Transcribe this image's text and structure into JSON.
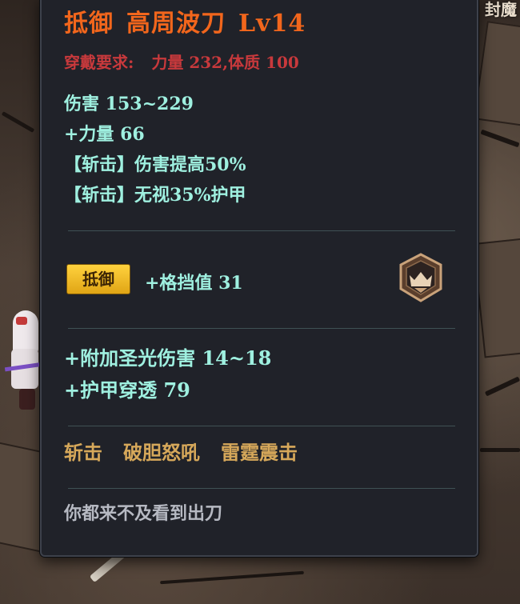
{
  "background": {
    "corner_text": "封魔"
  },
  "item": {
    "type_label": "抵御",
    "name": "高周波刀",
    "level": "Lv14",
    "requirement_label": "穿戴要求:",
    "requirement_value": "力量 232,体质 100"
  },
  "base_stats": [
    "伤害   153~229",
    "+力量 66",
    "【斩击】伤害提高50%",
    "【斩击】无视35%护甲"
  ],
  "affix": {
    "badge_label": "抵御",
    "stat": "+格挡值 31",
    "icon": "shield-crest-icon"
  },
  "extra_stats": [
    "+附加圣光伤害 14~18",
    "+护甲穿透 79"
  ],
  "skills": [
    "斩击",
    "破胆怒吼",
    "雷霆震击"
  ],
  "flavor_text": "你都来不及看到出刀",
  "colors": {
    "title": "#f2661c",
    "requirement": "#c8393c",
    "stat": "#9ff0e0",
    "skill": "#d6a85a",
    "flavor": "#b6b9c2",
    "badge": "#f0b923",
    "panel": "#202229"
  }
}
